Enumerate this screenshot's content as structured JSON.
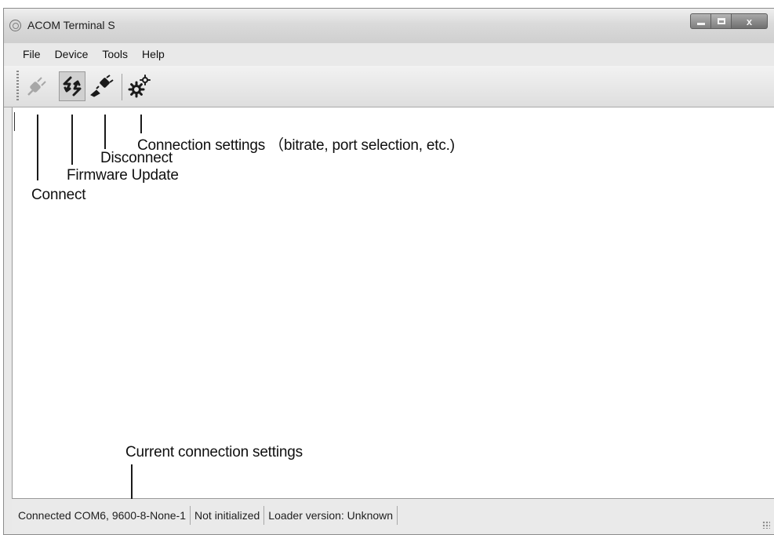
{
  "window": {
    "title": "ACOM Terminal S",
    "controls": {
      "minimize": "minimize",
      "maximize": "maximize",
      "close": "x"
    }
  },
  "menubar": {
    "items": [
      "File",
      "Device",
      "Tools",
      "Help"
    ]
  },
  "toolbar": {
    "buttons": [
      {
        "icon": "plug-connect-icon",
        "state": "disabled"
      },
      {
        "icon": "firmware-update-arrows-icon",
        "state": "pressed"
      },
      {
        "icon": "plug-disconnect-icon",
        "state": "enabled"
      },
      {
        "icon": "gears-settings-icon",
        "state": "enabled"
      }
    ]
  },
  "annotations": {
    "connection_settings": "Connection settings （bitrate, port selection, etc.)",
    "disconnect": "Disconnect",
    "firmware_update": "Firmware Update",
    "connect": "Connect",
    "current_connection_settings": "Current connection settings"
  },
  "statusbar": {
    "connection": "Connected COM6, 9600-8-None-1",
    "init_state": "Not initialized",
    "loader": "Loader version: Unknown"
  },
  "colors": {
    "text": "#1e1e1e",
    "annotation": "#0f0f0f",
    "chrome": "#e9e9e9",
    "client": "#ffffff"
  }
}
